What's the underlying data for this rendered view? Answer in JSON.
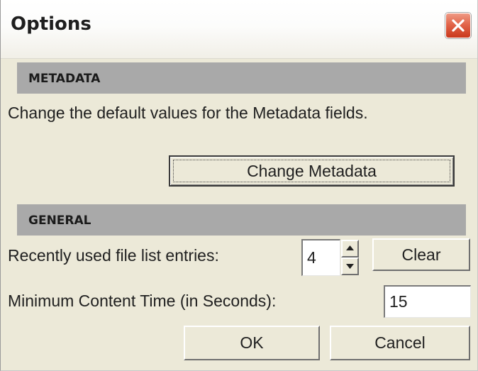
{
  "window": {
    "title": "Options"
  },
  "metadata": {
    "header": "METADATA",
    "description": "Change the default values for the Metadata fields.",
    "change_button": "Change Metadata"
  },
  "general": {
    "header": "GENERAL",
    "recent_label": "Recently used file list entries:",
    "recent_value": "4",
    "clear_button": "Clear",
    "min_time_label": "Minimum Content Time (in Seconds):",
    "min_time_value": "15"
  },
  "footer": {
    "ok_button": "OK",
    "cancel_button": "Cancel"
  },
  "icons": {
    "close": "close-icon",
    "spin_up": "chevron-up-icon",
    "spin_down": "chevron-down-icon"
  },
  "colors": {
    "dialog_bg": "#ece9d8",
    "section_header_bg": "#a9a9a9",
    "close_button": "#d9482b"
  }
}
